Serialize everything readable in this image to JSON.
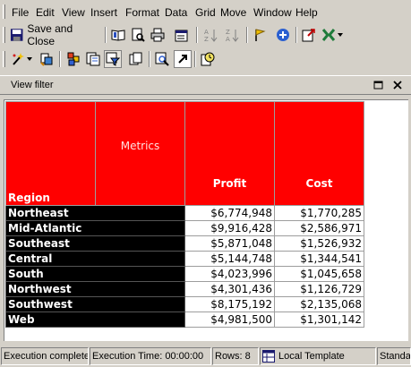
{
  "menu": {
    "items": [
      "File",
      "Edit",
      "View",
      "Insert",
      "Format",
      "Data",
      "Grid",
      "Move",
      "Window",
      "Help"
    ]
  },
  "toolbar": {
    "save_close_label": "Save and Close"
  },
  "view_filter": {
    "label": "View filter"
  },
  "grid": {
    "headers": {
      "row_header": "Region",
      "metrics": "Metrics",
      "columns": [
        "Profit",
        "Cost"
      ]
    },
    "rows": [
      {
        "region": "Northeast",
        "profit": "$6,774,948",
        "cost": "$1,770,285"
      },
      {
        "region": "Mid-Atlantic",
        "profit": "$9,916,428",
        "cost": "$2,586,971"
      },
      {
        "region": "Southeast",
        "profit": "$5,871,048",
        "cost": "$1,526,932"
      },
      {
        "region": "Central",
        "profit": "$5,144,748",
        "cost": "$1,344,541"
      },
      {
        "region": "South",
        "profit": "$4,023,996",
        "cost": "$1,045,658"
      },
      {
        "region": "Northwest",
        "profit": "$4,301,436",
        "cost": "$1,126,729"
      },
      {
        "region": "Southwest",
        "profit": "$8,175,192",
        "cost": "$2,135,068"
      },
      {
        "region": "Web",
        "profit": "$4,981,500",
        "cost": "$1,301,142"
      }
    ]
  },
  "status": {
    "message": "Execution complete",
    "execution_time": "Execution Time: 00:00:00",
    "rows": "Rows: 8",
    "template": "Local Template",
    "mode": "Standard"
  },
  "colors": {
    "header_bg": "#ff0000",
    "row_header_bg": "#000000",
    "chrome": "#d4d0c8"
  }
}
